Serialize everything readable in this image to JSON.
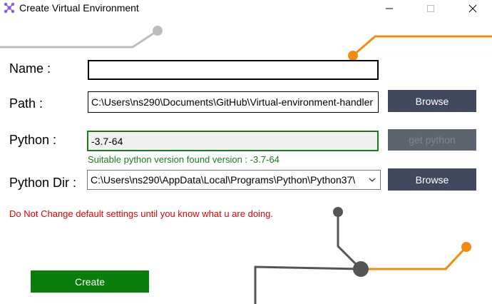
{
  "window": {
    "title": "Create Virtual Environment"
  },
  "form": {
    "name_label": "Name :",
    "name_value": "",
    "path_label": "Path :",
    "path_value": "C:\\Users\\ns290\\Documents\\GitHub\\Virtual-environment-handler",
    "python_label": "Python :",
    "python_value": "-3.7-64",
    "python_status": "Suitable python version found version : -3.7-64",
    "python_dir_label": "Python Dir :",
    "python_dir_value": "C:\\Users\\ns290\\AppData\\Local\\Programs\\Python\\Python37\\"
  },
  "buttons": {
    "browse_path": "Browse",
    "get_python": "get python",
    "browse_dir": "Browse",
    "create": "Create"
  },
  "warning": "Do Not Change default settings until you know what u are doing.",
  "colors": {
    "button_bg": "#404a5c",
    "create_bg": "#0b7d0b",
    "status_green": "#1a7c1a",
    "warning_red": "#e00000",
    "accent_orange": "#f28c0f",
    "line_gray": "#bdbdbd"
  }
}
